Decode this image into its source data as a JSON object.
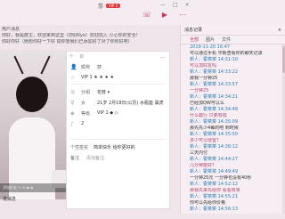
{
  "window": {
    "title": "莎",
    "badge": "VIP 1",
    "controls": [
      "—",
      "□",
      "×"
    ]
  },
  "toolbar": {
    "icons": [
      "phone-icon",
      "video-icon",
      "more-icon"
    ]
  },
  "notice": {
    "lines": [
      "用户消息",
      "你好，我是群主，欢迎来到这里（你好Kyo）欢迎加入 小心你的安全！",
      "你好你好（她想你好一下好 如你想我们已添加好了对了你你好吧）"
    ]
  },
  "photo": {
    "caption": "添加好友 ⊙ ⊘ ◉ ◈",
    "send_label": "发消息"
  },
  "profile": {
    "header_icons": [
      "plus-icon",
      "gear-icon"
    ],
    "more": "…",
    "rows": [
      {
        "icon": "👤",
        "label": "昵称",
        "value": "莎"
      },
      {
        "icon": "☆",
        "label": "",
        "value": "VIP 1  ★ ★ ★ ★"
      },
      {
        "icon": "◎",
        "label": "分组",
        "value": "花枝 ▾"
      },
      {
        "icon": "♀",
        "label": "女",
        "value": "21岁  2月18日(公历)  水瓶座  属虎"
      },
      {
        "icon": "◈",
        "label": "等级",
        "value": "VIP 1  ◆ ◇"
      },
      {
        "icon": "♪",
        "label": "",
        "value": "2"
      }
    ],
    "sign_label": "个性签名",
    "sign_value": "简单快乐 给你更好的",
    "remark_label": "备注",
    "remark_value": "添加备注"
  },
  "history": {
    "title": "消息记录",
    "tabs": [
      "全部",
      "图片",
      "文件"
    ],
    "messages": [
      {
        "time": "2019-11-20 16:47",
        "text": "可以通过手机 平板查看你的聊天记录"
      },
      {
        "time": "新人：霍菜菜 14:31:10",
        "text": "可以加好友吗"
      },
      {
        "time": "新人：霍菜菜 14:33:22",
        "text": "那我一分钟25"
      },
      {
        "time": "新人：霍菜菜 14:33:57",
        "text": "一分钟25"
      },
      {
        "time": "新人：霍菜菜 14:34:21",
        "text": "已经加QW可以么"
      },
      {
        "time": "新人：霍菜菜 14:34:48",
        "text": "什么都行 只要有钱"
      },
      {
        "time": "新人：霍菜菜 14:35:09",
        "text": "那先先少4每的吧 到时候"
      },
      {
        "time": "新人：霍菜菜 14:35:50",
        "text": "多少可以便宜?"
      },
      {
        "time": "新人：霍菜菜 14:36:12",
        "text": "三天内付"
      },
      {
        "time": "新人：霍菜菜 14:44:27",
        "text": "几分钟能好?"
      },
      {
        "time": "新人：霍菜菜 14:49:49",
        "text": "一分钟25元 一分钟也没有40秒"
      },
      {
        "time": "新人：霍菜菜 14:52:12",
        "text": "那我先来先给你 看看效果"
      },
      {
        "time": "新人：霍菜菜 14:55:21",
        "text": "你可以先给你价格"
      },
      {
        "time": "新人：霍菜菜 14:56:13",
        "text": ""
      }
    ]
  }
}
